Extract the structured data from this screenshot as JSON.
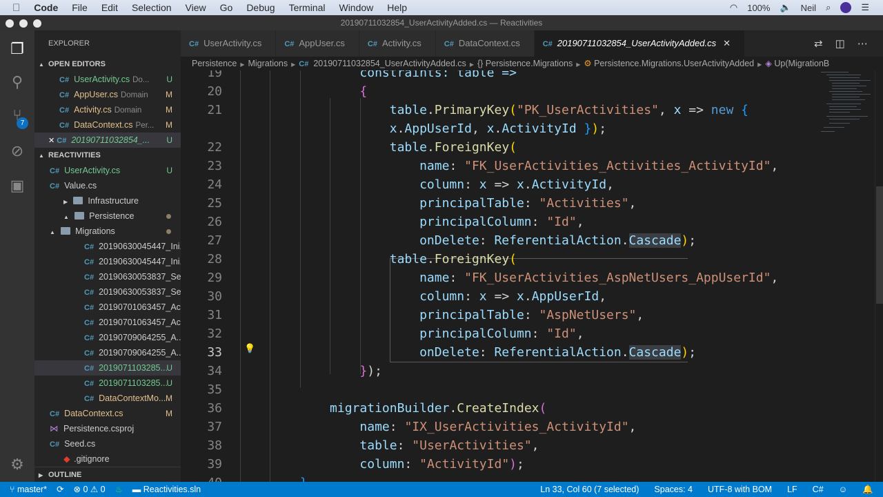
{
  "menubar": {
    "app": "Code",
    "items": [
      "File",
      "Edit",
      "Selection",
      "View",
      "Go",
      "Debug",
      "Terminal",
      "Window",
      "Help"
    ],
    "battery": "100%",
    "user": "Neil"
  },
  "window_title": "20190711032854_UserActivityAdded.cs — Reactivities",
  "sidebar": {
    "title": "EXPLORER",
    "open_editors_label": "OPEN EDITORS",
    "open_editors": [
      {
        "name": "UserActivity.cs",
        "desc": "Do...",
        "status": "U",
        "color": "green"
      },
      {
        "name": "AppUser.cs",
        "desc": "Domain",
        "status": "M",
        "color": "mod"
      },
      {
        "name": "Activity.cs",
        "desc": "Domain",
        "status": "M",
        "color": "mod"
      },
      {
        "name": "DataContext.cs",
        "desc": "Per...",
        "status": "M",
        "color": "mod"
      },
      {
        "name": "20190711032854_...",
        "desc": "",
        "status": "U",
        "color": "green"
      }
    ],
    "project_label": "REACTIVITIES",
    "tree": [
      {
        "name": "UserActivity.cs",
        "status": "U",
        "kind": "cs",
        "indent": 1,
        "color": "green"
      },
      {
        "name": "Value.cs",
        "status": "",
        "kind": "cs",
        "indent": 1,
        "color": ""
      },
      {
        "name": "Infrastructure",
        "status": "",
        "kind": "folder-closed",
        "indent": 0,
        "color": ""
      },
      {
        "name": "Persistence",
        "status": "dot",
        "kind": "folder-open",
        "indent": 0,
        "color": ""
      },
      {
        "name": "Migrations",
        "status": "dot",
        "kind": "folder-open",
        "indent": 1,
        "color": ""
      },
      {
        "name": "20190630045447_Ini...",
        "status": "",
        "kind": "cs",
        "indent": 2,
        "color": ""
      },
      {
        "name": "20190630045447_Ini...",
        "status": "",
        "kind": "cs",
        "indent": 2,
        "color": ""
      },
      {
        "name": "20190630053837_Se...",
        "status": "",
        "kind": "cs",
        "indent": 2,
        "color": ""
      },
      {
        "name": "20190630053837_Se...",
        "status": "",
        "kind": "cs",
        "indent": 2,
        "color": ""
      },
      {
        "name": "20190701063457_Ac...",
        "status": "",
        "kind": "cs",
        "indent": 2,
        "color": ""
      },
      {
        "name": "20190701063457_Ac...",
        "status": "",
        "kind": "cs",
        "indent": 2,
        "color": ""
      },
      {
        "name": "20190709064255_A...",
        "status": "",
        "kind": "cs",
        "indent": 2,
        "color": ""
      },
      {
        "name": "20190709064255_A...",
        "status": "",
        "kind": "cs",
        "indent": 2,
        "color": ""
      },
      {
        "name": "2019071103285...",
        "status": "U",
        "kind": "cs",
        "indent": 2,
        "color": "green",
        "selected": true
      },
      {
        "name": "2019071103285...",
        "status": "U",
        "kind": "cs",
        "indent": 2,
        "color": "green"
      },
      {
        "name": "DataContextMo...",
        "status": "M",
        "kind": "cs",
        "indent": 2,
        "color": "mod"
      },
      {
        "name": "DataContext.cs",
        "status": "M",
        "kind": "cs",
        "indent": 1,
        "color": "mod"
      },
      {
        "name": "Persistence.csproj",
        "status": "",
        "kind": "csproj",
        "indent": 1,
        "color": ""
      },
      {
        "name": "Seed.cs",
        "status": "",
        "kind": "cs",
        "indent": 1,
        "color": ""
      },
      {
        "name": ".gitignore",
        "status": "",
        "kind": "git",
        "indent": 0,
        "color": ""
      }
    ],
    "outline_label": "OUTLINE",
    "scm_badge": "7"
  },
  "tabs": [
    {
      "label": "UserActivity.cs"
    },
    {
      "label": "AppUser.cs"
    },
    {
      "label": "Activity.cs"
    },
    {
      "label": "DataContext.cs"
    },
    {
      "label": "20190711032854_UserActivityAdded.cs",
      "active": true
    }
  ],
  "breadcrumb": [
    "Persistence",
    "Migrations",
    "20190711032854_UserActivityAdded.cs",
    "{} Persistence.Migrations",
    "Persistence.Migrations.UserActivityAdded",
    "Up(MigrationB"
  ],
  "editor": {
    "current_line": "33",
    "lines": [
      {
        "n": "19",
        "t": [
          [
            "                constraints: ",
            "var"
          ],
          [
            "table =>",
            "var"
          ]
        ]
      },
      {
        "n": "20",
        "t": [
          [
            "                ",
            "p"
          ],
          [
            "{",
            "br1"
          ]
        ]
      },
      {
        "n": "21",
        "t": [
          [
            "                    table",
            "var"
          ],
          [
            ".",
            "p"
          ],
          [
            "PrimaryKey",
            "fn"
          ],
          [
            "(",
            "br2"
          ],
          [
            "\"PK_UserActivities\"",
            "str"
          ],
          [
            ", ",
            "p"
          ],
          [
            "x",
            "var"
          ],
          [
            " => ",
            "p"
          ],
          [
            "new",
            "kw"
          ],
          [
            " {",
            "br3"
          ]
        ]
      },
      {
        "n": "",
        "t": [
          [
            "                    x",
            "var"
          ],
          [
            ".",
            "p"
          ],
          [
            "AppUserId",
            "var"
          ],
          [
            ", ",
            "p"
          ],
          [
            "x",
            "var"
          ],
          [
            ".",
            "p"
          ],
          [
            "ActivityId",
            "var"
          ],
          [
            " }",
            "br3"
          ],
          [
            ")",
            "br2"
          ],
          [
            ";",
            "p"
          ]
        ]
      },
      {
        "n": "22",
        "t": [
          [
            "                    table",
            "var"
          ],
          [
            ".",
            "p"
          ],
          [
            "ForeignKey",
            "fn"
          ],
          [
            "(",
            "br2"
          ]
        ]
      },
      {
        "n": "23",
        "t": [
          [
            "                        name",
            "var"
          ],
          [
            ": ",
            "p"
          ],
          [
            "\"FK_UserActivities_Activities_ActivityId\"",
            "str"
          ],
          [
            ",",
            "p"
          ]
        ]
      },
      {
        "n": "24",
        "t": [
          [
            "                        column",
            "var"
          ],
          [
            ": ",
            "p"
          ],
          [
            "x",
            "var"
          ],
          [
            " => ",
            "p"
          ],
          [
            "x",
            "var"
          ],
          [
            ".",
            "p"
          ],
          [
            "ActivityId",
            "var"
          ],
          [
            ",",
            "p"
          ]
        ]
      },
      {
        "n": "25",
        "t": [
          [
            "                        principalTable",
            "var"
          ],
          [
            ": ",
            "p"
          ],
          [
            "\"Activities\"",
            "str"
          ],
          [
            ",",
            "p"
          ]
        ]
      },
      {
        "n": "26",
        "t": [
          [
            "                        principalColumn",
            "var"
          ],
          [
            ": ",
            "p"
          ],
          [
            "\"Id\"",
            "str"
          ],
          [
            ",",
            "p"
          ]
        ]
      },
      {
        "n": "27",
        "t": [
          [
            "                        onDelete",
            "var"
          ],
          [
            ": ",
            "p"
          ],
          [
            "ReferentialAction",
            "var"
          ],
          [
            ".",
            "p"
          ],
          [
            "Cascade",
            "hl"
          ],
          [
            ")",
            "br2"
          ],
          [
            ";",
            "p"
          ]
        ]
      },
      {
        "n": "28",
        "t": [
          [
            "                    table",
            "var"
          ],
          [
            ".",
            "p"
          ],
          [
            "ForeignKey",
            "fn"
          ],
          [
            "(",
            "br2"
          ]
        ]
      },
      {
        "n": "29",
        "t": [
          [
            "                        name",
            "var"
          ],
          [
            ": ",
            "p"
          ],
          [
            "\"FK_UserActivities_AspNetUsers_AppUserId\"",
            "str"
          ],
          [
            ",",
            "p"
          ]
        ]
      },
      {
        "n": "30",
        "t": [
          [
            "                        column",
            "var"
          ],
          [
            ": ",
            "p"
          ],
          [
            "x",
            "var"
          ],
          [
            " => ",
            "p"
          ],
          [
            "x",
            "var"
          ],
          [
            ".",
            "p"
          ],
          [
            "AppUserId",
            "var"
          ],
          [
            ",",
            "p"
          ]
        ]
      },
      {
        "n": "31",
        "t": [
          [
            "                        principalTable",
            "var"
          ],
          [
            ": ",
            "p"
          ],
          [
            "\"AspNetUsers\"",
            "str"
          ],
          [
            ",",
            "p"
          ]
        ]
      },
      {
        "n": "32",
        "t": [
          [
            "                        principalColumn",
            "var"
          ],
          [
            ": ",
            "p"
          ],
          [
            "\"Id\"",
            "str"
          ],
          [
            ",",
            "p"
          ]
        ]
      },
      {
        "n": "33",
        "t": [
          [
            "                        onDelete",
            "var"
          ],
          [
            ": ",
            "p"
          ],
          [
            "ReferentialAction",
            "var"
          ],
          [
            ".",
            "p"
          ],
          [
            "Cascade",
            "hl"
          ],
          [
            ")",
            "br2"
          ],
          [
            ";",
            "p"
          ]
        ]
      },
      {
        "n": "34",
        "t": [
          [
            "                ",
            "p"
          ],
          [
            "}",
            "br1"
          ],
          [
            ");",
            "p"
          ]
        ]
      },
      {
        "n": "35",
        "t": []
      },
      {
        "n": "36",
        "t": [
          [
            "            migrationBuilder",
            "var"
          ],
          [
            ".",
            "p"
          ],
          [
            "CreateIndex",
            "fn"
          ],
          [
            "(",
            "br1"
          ]
        ]
      },
      {
        "n": "37",
        "t": [
          [
            "                name",
            "var"
          ],
          [
            ": ",
            "p"
          ],
          [
            "\"IX_UserActivities_ActivityId\"",
            "str"
          ],
          [
            ",",
            "p"
          ]
        ]
      },
      {
        "n": "38",
        "t": [
          [
            "                table",
            "var"
          ],
          [
            ": ",
            "p"
          ],
          [
            "\"UserActivities\"",
            "str"
          ],
          [
            ",",
            "p"
          ]
        ]
      },
      {
        "n": "39",
        "t": [
          [
            "                column",
            "var"
          ],
          [
            ": ",
            "p"
          ],
          [
            "\"ActivityId\"",
            "str"
          ],
          [
            ")",
            "br1"
          ],
          [
            ";",
            "p"
          ]
        ]
      },
      {
        "n": "40",
        "t": [
          [
            "        }",
            "br3"
          ]
        ]
      }
    ]
  },
  "status": {
    "branch": "master*",
    "errors": "0",
    "warnings": "0",
    "solution": "Reactivities.sln",
    "position": "Ln 33, Col 60 (7 selected)",
    "indent": "Spaces: 4",
    "encoding": "UTF-8 with BOM",
    "eol": "LF",
    "language": "C#"
  }
}
